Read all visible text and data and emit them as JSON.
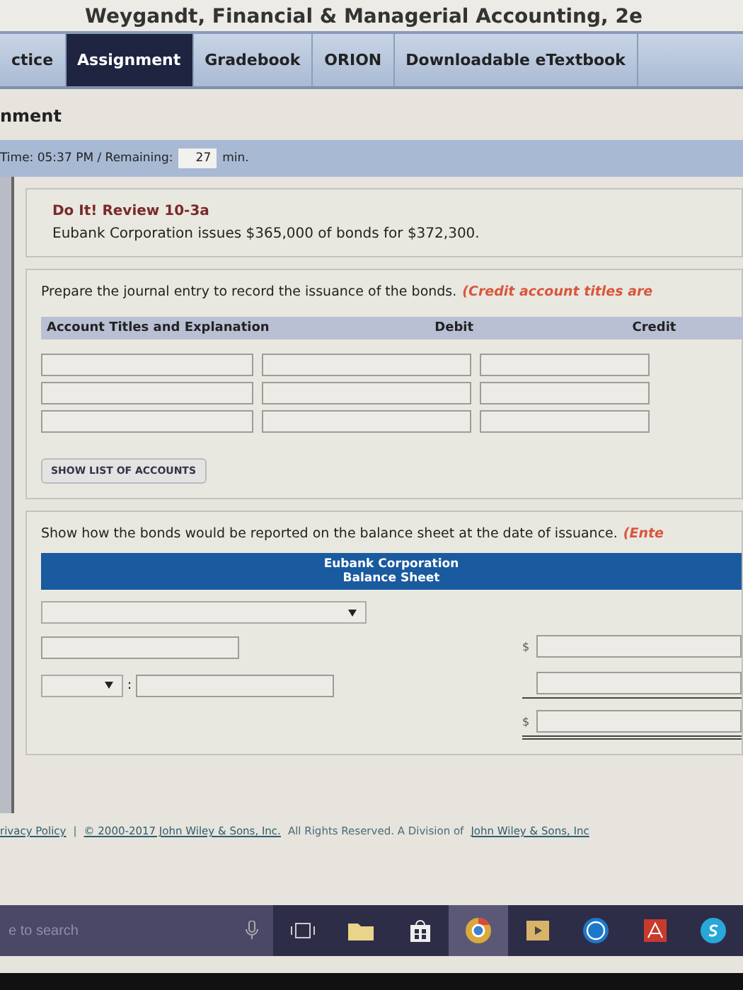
{
  "book_title": "Weygandt, Financial & Managerial Accounting, 2e",
  "tabs": [
    {
      "label": "ctice",
      "selected": false
    },
    {
      "label": "Assignment",
      "selected": true
    },
    {
      "label": "Gradebook",
      "selected": false
    },
    {
      "label": "ORION",
      "selected": false
    },
    {
      "label": "Downloadable eTextbook",
      "selected": false
    }
  ],
  "page_heading": "nment",
  "timer": {
    "label": "Time: 05:37 PM / Remaining:",
    "minutes": "27",
    "unit": "min."
  },
  "question": {
    "title": "Do It! Review 10-3a",
    "text": "Eubank Corporation issues $365,000 of bonds for $372,300."
  },
  "journal": {
    "instruction": "Prepare the journal entry to record the issuance of the bonds.",
    "note": "(Credit account titles are",
    "columns": [
      "Account Titles and Explanation",
      "Debit",
      "Credit"
    ],
    "rows": [
      {
        "kind": "entry"
      },
      {
        "kind": "entry"
      },
      {
        "kind": "entry"
      }
    ],
    "button": "SHOW LIST OF ACCOUNTS"
  },
  "balance_sheet": {
    "instruction": "Show how the bonds would be reported on the balance sheet at the date of issuance.",
    "note": "(Ente",
    "company": "Eubank Corporation",
    "statement": "Balance Sheet",
    "lines": [
      {
        "kind": "heading"
      },
      {
        "kind": "item",
        "currency": "$"
      },
      {
        "kind": "sub_item",
        "separator": ":"
      },
      {
        "kind": "total",
        "currency": "$"
      }
    ]
  },
  "footer": {
    "privacy": "rivacy Policy",
    "separator": "|",
    "copyright": "© 2000-2017 John Wiley & Sons, Inc.",
    "rights": "All Rights Reserved. A Division of",
    "company": "John Wiley & Sons, Inc"
  },
  "taskbar": {
    "search_placeholder": "e to search"
  }
}
